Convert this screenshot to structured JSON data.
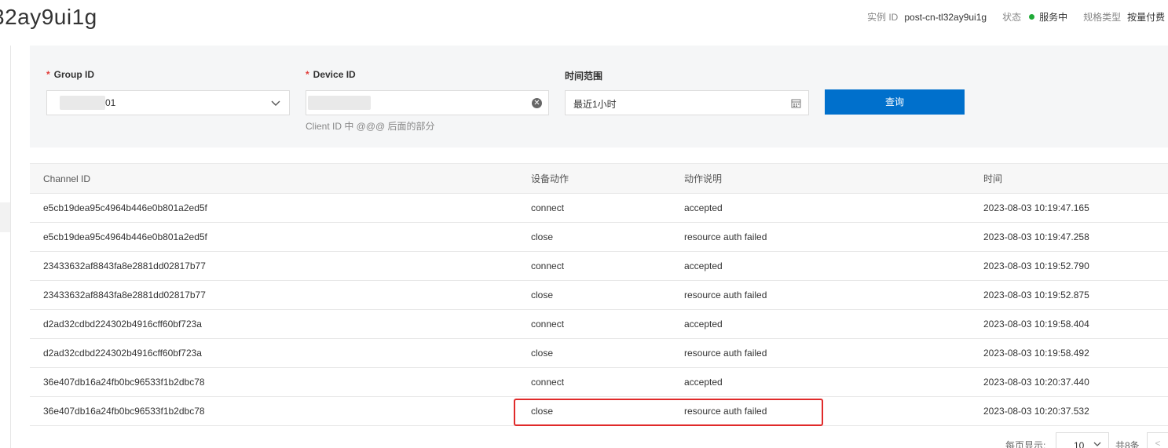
{
  "header": {
    "title": "32ay9ui1g",
    "instance_label": "实例 ID",
    "instance_value": "post-cn-tl32ay9ui1g",
    "status_label": "状态",
    "status_value": "服务中",
    "status_color": "#1faa37",
    "spec_label": "规格类型",
    "spec_value": "按量付费"
  },
  "filters": {
    "group_id": {
      "label": "Group ID",
      "required_mark": "*",
      "value": "01"
    },
    "device_id": {
      "label": "Device ID",
      "required_mark": "*",
      "hint": "Client ID 中 @@@ 后面的部分"
    },
    "time_range": {
      "label": "时间范围",
      "value": "最近1小时"
    },
    "query_button": "查询"
  },
  "table": {
    "columns": [
      "Channel ID",
      "设备动作",
      "动作说明",
      "时间"
    ],
    "rows": [
      [
        "e5cb19dea95c4964b446e0b801a2ed5f",
        "connect",
        "accepted",
        "2023-08-03 10:19:47.165"
      ],
      [
        "e5cb19dea95c4964b446e0b801a2ed5f",
        "close",
        "resource auth failed",
        "2023-08-03 10:19:47.258"
      ],
      [
        "23433632af8843fa8e2881dd02817b77",
        "connect",
        "accepted",
        "2023-08-03 10:19:52.790"
      ],
      [
        "23433632af8843fa8e2881dd02817b77",
        "close",
        "resource auth failed",
        "2023-08-03 10:19:52.875"
      ],
      [
        "d2ad32cdbd224302b4916cff60bf723a",
        "connect",
        "accepted",
        "2023-08-03 10:19:58.404"
      ],
      [
        "d2ad32cdbd224302b4916cff60bf723a",
        "close",
        "resource auth failed",
        "2023-08-03 10:19:58.492"
      ],
      [
        "36e407db16a24fb0bc96533f1b2dbc78",
        "connect",
        "accepted",
        "2023-08-03 10:20:37.440"
      ],
      [
        "36e407db16a24fb0bc96533f1b2dbc78",
        "close",
        "resource auth failed",
        "2023-08-03 10:20:37.532"
      ]
    ]
  },
  "pagination": {
    "page_size_label": "每页显示:",
    "page_size": "10",
    "total": "共8条",
    "prev": "<"
  }
}
